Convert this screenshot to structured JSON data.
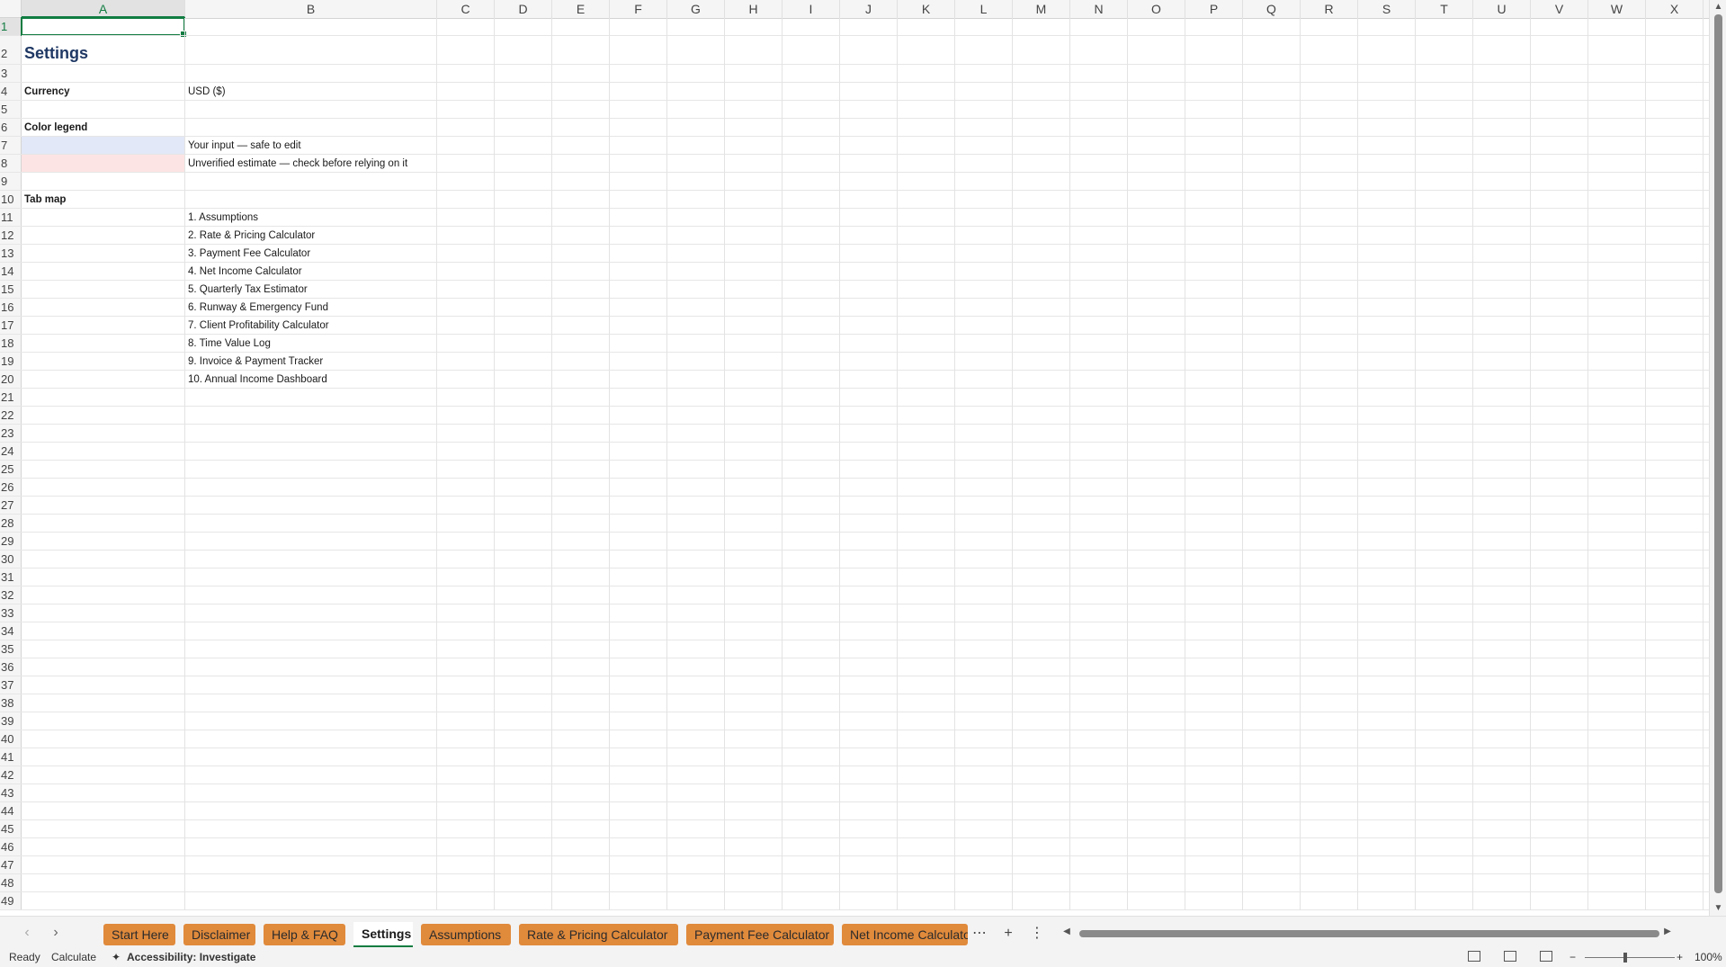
{
  "columns": [
    "A",
    "B",
    "C",
    "D",
    "E",
    "F",
    "G",
    "H",
    "I",
    "J",
    "K",
    "L",
    "M",
    "N",
    "O",
    "P",
    "Q",
    "R",
    "S",
    "T",
    "U",
    "V",
    "W",
    "X"
  ],
  "selected_column": "A",
  "selected_row": 1,
  "rows_visible": [
    1,
    2,
    3,
    4,
    5,
    6,
    7,
    8,
    9,
    10,
    11,
    12,
    13,
    14,
    15,
    16,
    17,
    18,
    19,
    20,
    21,
    22,
    23,
    24,
    25,
    26,
    27,
    28,
    29,
    30,
    31,
    32,
    33,
    34,
    35,
    36,
    37,
    38,
    39,
    40,
    41,
    42,
    43,
    44,
    45,
    46,
    47,
    48,
    49
  ],
  "sheet": {
    "title": "Settings",
    "currency_label": "Currency",
    "currency_value": "USD ($)",
    "legend_label": "Color legend",
    "legend_input_text": "Your input — safe to edit",
    "legend_estimate_text": "Unverified estimate — check before relying on it",
    "legend_input_color": "#e3e8f8",
    "legend_estimate_color": "#fde4e4",
    "tabmap_label": "Tab map",
    "tabmap_items": [
      "1. Assumptions",
      "2. Rate & Pricing Calculator",
      "3. Payment Fee Calculator",
      "4. Net Income Calculator",
      "5. Quarterly Tax Estimator",
      "6. Runway & Emergency Fund",
      "7. Client Profitability Calculator",
      "8. Time Value Log",
      "9. Invoice & Payment Tracker",
      "10. Annual Income Dashboard"
    ]
  },
  "tabs": {
    "items": [
      "Start Here",
      "Disclaimer",
      "Help & FAQ",
      "Settings",
      "Assumptions",
      "Rate & Pricing Calculator",
      "Payment Fee Calculator",
      "Net Income Calculator"
    ],
    "active": "Settings",
    "tab_color": "#e08a3c"
  },
  "status": {
    "ready": "Ready",
    "calculate": "Calculate",
    "accessibility": "Accessibility: Investigate",
    "zoom": "100%",
    "zoom_minus": "−",
    "zoom_plus": "+"
  },
  "icons": {
    "prev_sheet": "chevron-left-icon",
    "next_sheet": "chevron-right-icon",
    "more_sheets": "ellipsis-icon",
    "add_sheet": "plus-icon",
    "options": "vertical-dots-icon"
  }
}
